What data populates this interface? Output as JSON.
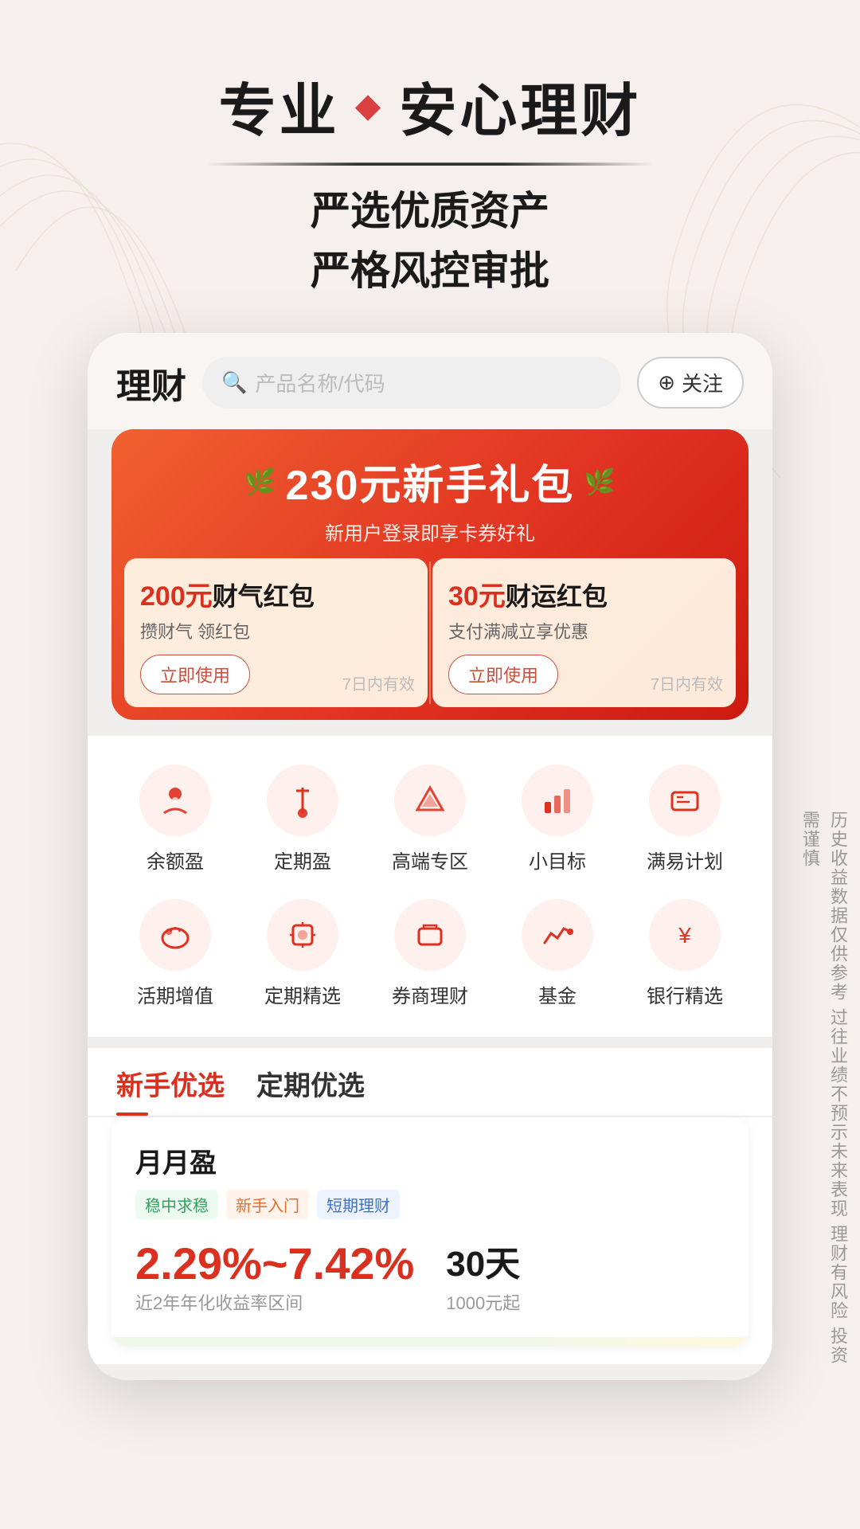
{
  "header": {
    "title_left": "专业",
    "diamond": "◆",
    "title_right": "安心理财",
    "subtitle_line1": "严选优质资产",
    "subtitle_line2": "严格风控审批"
  },
  "app": {
    "title": "理财",
    "search_placeholder": "产品名称/代码",
    "follow_label": "关注"
  },
  "banner": {
    "title": "230元新手礼包",
    "subtitle": "新用户登录即享卡券好礼",
    "card1": {
      "amount": "200元",
      "title": "财气红包",
      "desc": "攒财气 领红包",
      "btn": "立即使用",
      "validity": "7日内有效"
    },
    "card2": {
      "amount": "30元",
      "title": "财运红包",
      "desc": "支付满减立享优惠",
      "btn": "立即使用",
      "validity": "7日内有效"
    }
  },
  "menu": {
    "row1": [
      {
        "label": "余额盈",
        "icon": "👤"
      },
      {
        "label": "定期盈",
        "icon": "📍"
      },
      {
        "label": "高端专区",
        "icon": "💎"
      },
      {
        "label": "小目标",
        "icon": "📊"
      },
      {
        "label": "满易计划",
        "icon": "💳"
      }
    ],
    "row2": [
      {
        "label": "活期增值",
        "icon": "🐷"
      },
      {
        "label": "定期精选",
        "icon": "⏳"
      },
      {
        "label": "券商理财",
        "icon": "💼"
      },
      {
        "label": "基金",
        "icon": "📈"
      },
      {
        "label": "银行精选",
        "icon": "💰"
      }
    ]
  },
  "tabs": [
    {
      "label": "新手优选",
      "active": true
    },
    {
      "label": "定期优选",
      "active": false
    }
  ],
  "product": {
    "name": "月月盈",
    "tags": [
      {
        "text": "稳中求稳",
        "style": "green"
      },
      {
        "text": "新手入门",
        "style": "orange"
      },
      {
        "text": "短期理财",
        "style": "blue"
      }
    ],
    "rate": "2.29%~7.42%",
    "rate_label": "近2年年化收益率区间",
    "period": "30天",
    "period_label": "1000元起"
  },
  "side_disclaimer": "历史收益数据仅供参考 过往业绩不预示未来表现 理财有风险 投资需谨慎"
}
